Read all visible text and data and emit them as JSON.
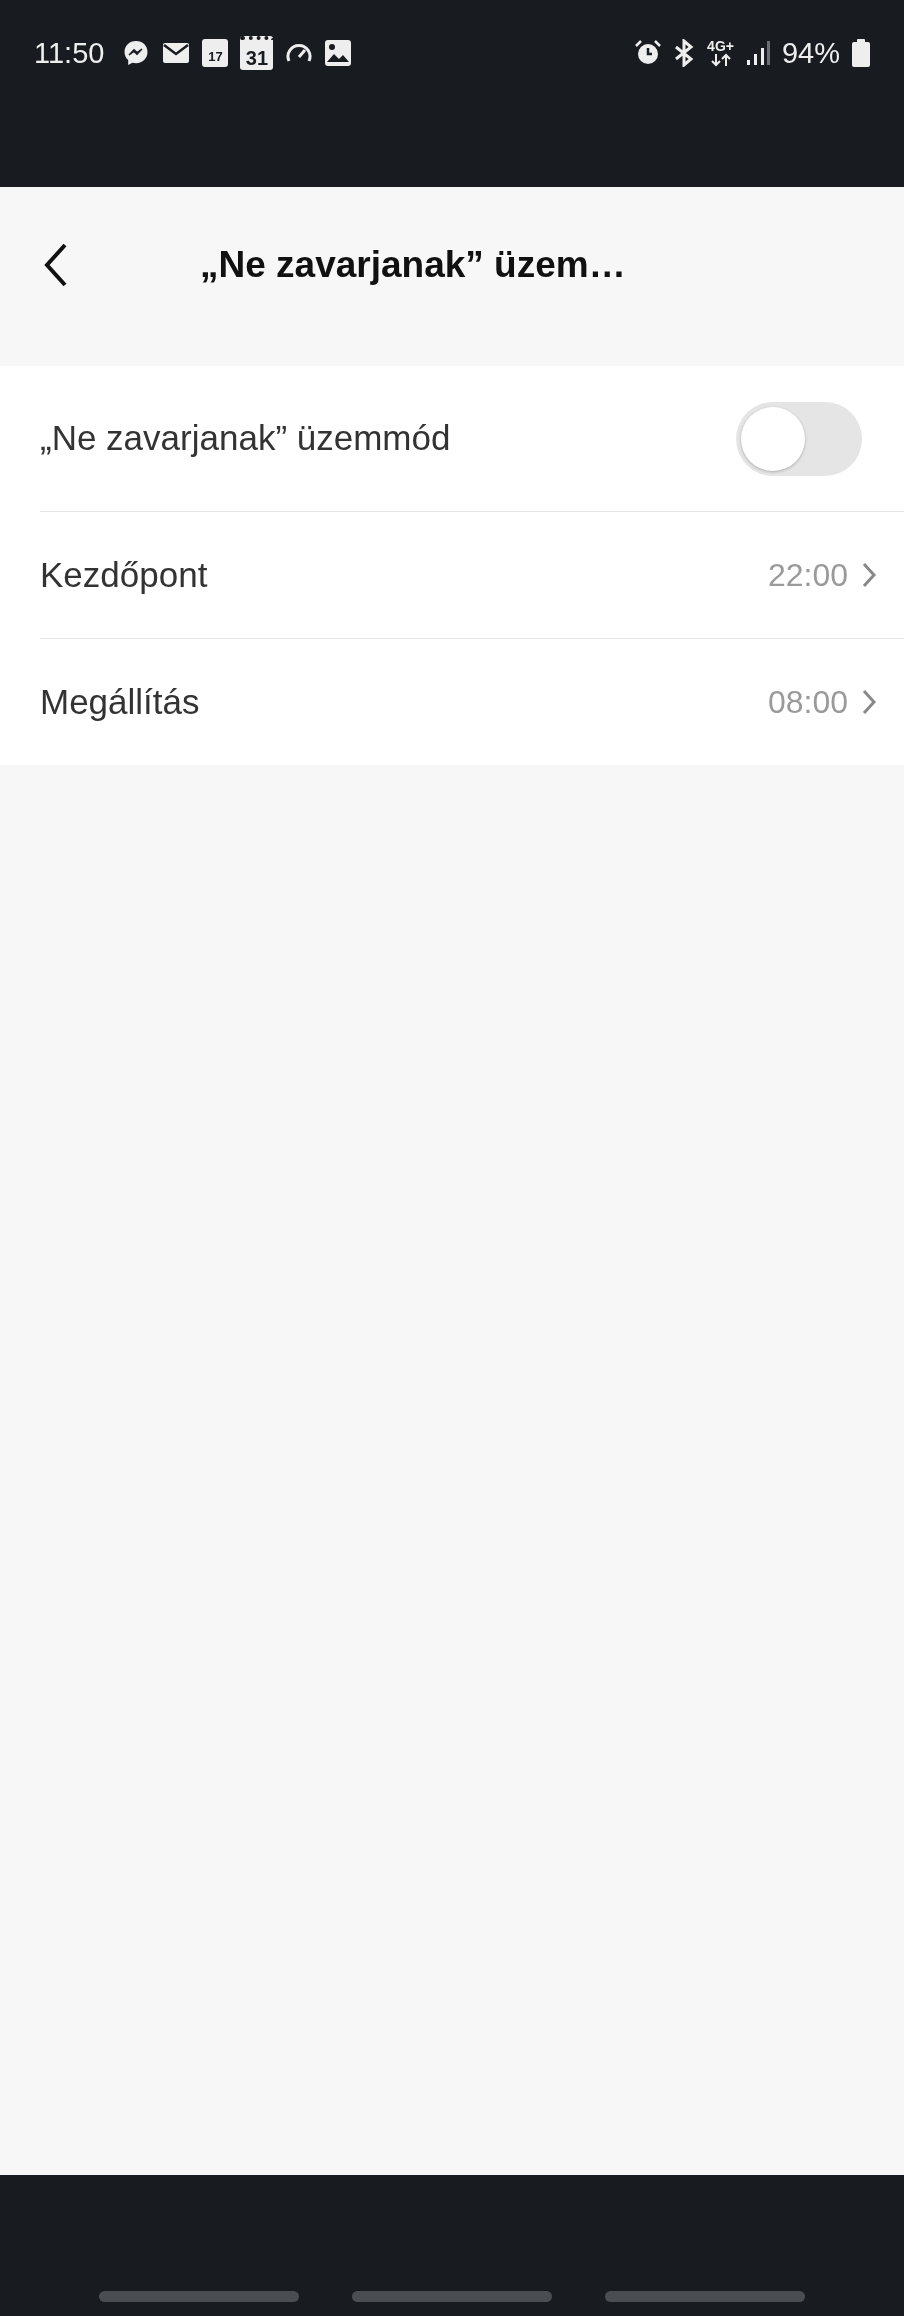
{
  "status_bar": {
    "time": "11:50",
    "calendar_day": "17",
    "calendar_date": "31",
    "network": "4G+",
    "battery": "94%"
  },
  "header": {
    "title": "„Ne zavarjanak” üzem…"
  },
  "settings": [
    {
      "kind": "toggle",
      "label": "„Ne zavarjanak” üzemmód",
      "on": false
    },
    {
      "kind": "link",
      "label": "Kezdőpont",
      "value": "22:00"
    },
    {
      "kind": "link",
      "label": "Megállítás",
      "value": "08:00"
    }
  ]
}
